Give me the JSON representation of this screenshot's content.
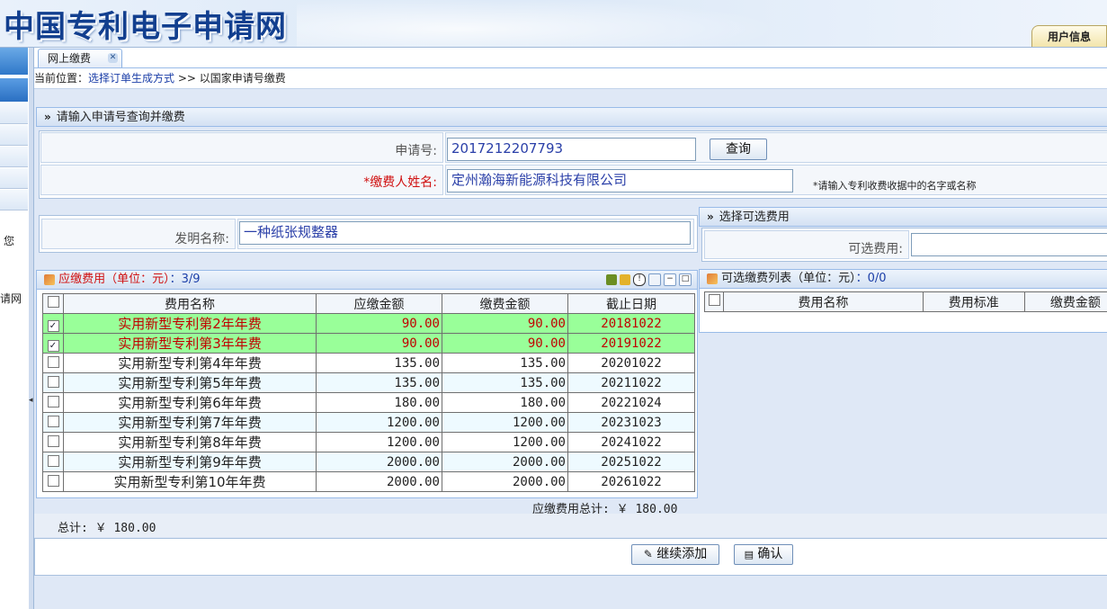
{
  "header": {
    "site_title": "中国专利电子申请网",
    "user_info_tab": "用户信息"
  },
  "sidebar": {
    "text1": "您",
    "text2": "请网"
  },
  "tabs": [
    {
      "label": "网上缴费"
    }
  ],
  "breadcrumb": {
    "prefix": "当前位置：",
    "link": "选择订单生成方式",
    "separator": ">>",
    "current": "以国家申请号缴费"
  },
  "query_panel": {
    "title": "请输入申请号查询并缴费",
    "application_no_label": "申请号:",
    "application_no_value": "2017212207793",
    "query_button": "查询",
    "payer_name_label": "*缴费人姓名:",
    "payer_name_value": "定州瀚海新能源科技有限公司",
    "payer_hint": "*请输入专利收费收据中的名字或名称"
  },
  "invention": {
    "label": "发明名称:",
    "value": "一种纸张规整器"
  },
  "fees_panel": {
    "title": "应缴费用（单位：元）",
    "count": "：3/9",
    "columns": [
      "费用名称",
      "应缴金额",
      "缴费金额",
      "截止日期"
    ],
    "rows": [
      {
        "checked": true,
        "name": "实用新型专利第2年年费",
        "due": "90.00",
        "pay": "90.00",
        "deadline": "20181022"
      },
      {
        "checked": true,
        "name": "实用新型专利第3年年费",
        "due": "90.00",
        "pay": "90.00",
        "deadline": "20191022"
      },
      {
        "checked": false,
        "name": "实用新型专利第4年年费",
        "due": "135.00",
        "pay": "135.00",
        "deadline": "20201022"
      },
      {
        "checked": false,
        "name": "实用新型专利第5年年费",
        "due": "135.00",
        "pay": "135.00",
        "deadline": "20211022"
      },
      {
        "checked": false,
        "name": "实用新型专利第6年年费",
        "due": "180.00",
        "pay": "180.00",
        "deadline": "20221024"
      },
      {
        "checked": false,
        "name": "实用新型专利第7年年费",
        "due": "1200.00",
        "pay": "1200.00",
        "deadline": "20231023"
      },
      {
        "checked": false,
        "name": "实用新型专利第8年年费",
        "due": "1200.00",
        "pay": "1200.00",
        "deadline": "20241022"
      },
      {
        "checked": false,
        "name": "实用新型专利第9年年费",
        "due": "2000.00",
        "pay": "2000.00",
        "deadline": "20251022"
      },
      {
        "checked": false,
        "name": "实用新型专利第10年年费",
        "due": "2000.00",
        "pay": "2000.00",
        "deadline": "20261022"
      }
    ],
    "subtotal": "应缴费用总计: ￥ 180.00"
  },
  "optional_panel": {
    "title": "选择可选费用",
    "field_label": "可选费用:",
    "field_value": ""
  },
  "optional_list": {
    "title": "可选缴费列表（单位：元）",
    "count": "：0/0",
    "columns": [
      "费用名称",
      "费用标准",
      "缴费金额"
    ]
  },
  "total": "总计: ￥ 180.00",
  "actions": {
    "continue_add": "继续添加",
    "confirm": "确认"
  }
}
